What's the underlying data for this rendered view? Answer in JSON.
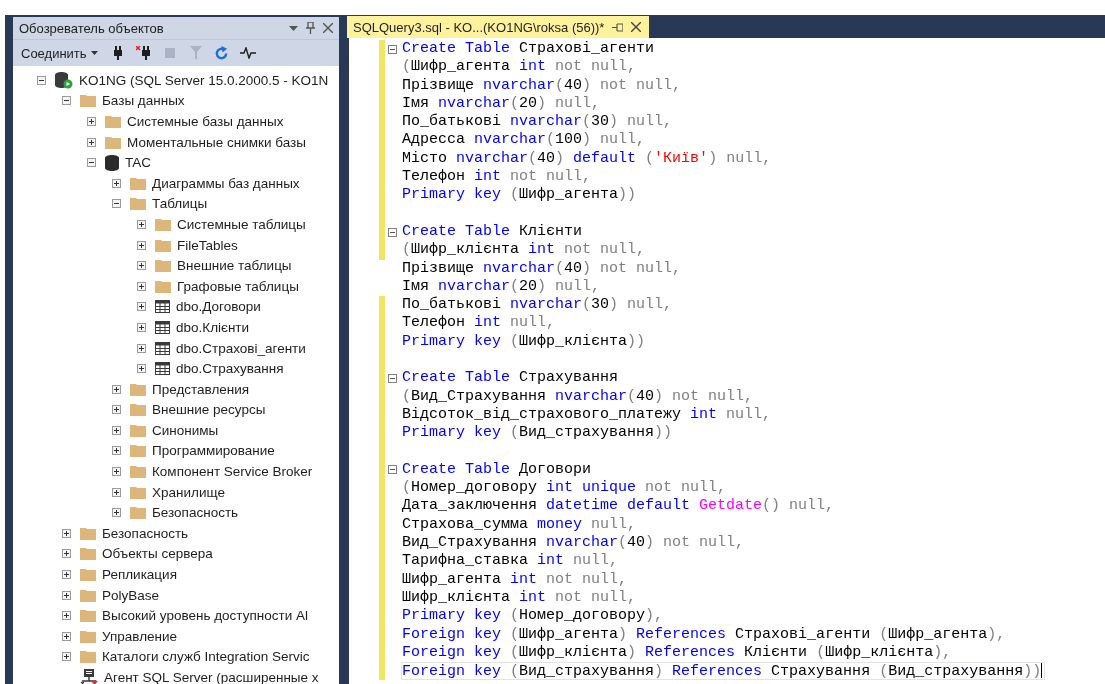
{
  "explorer": {
    "title": "Обозреватель объектов",
    "connect_label": "Соединить",
    "tools": [
      {
        "kind": "connect",
        "disabled": false
      },
      {
        "kind": "disconnect",
        "disabled": false
      },
      {
        "kind": "stop",
        "disabled": true
      },
      {
        "kind": "filter",
        "disabled": true
      },
      {
        "kind": "refresh",
        "disabled": false
      },
      {
        "kind": "activity",
        "disabled": false
      }
    ],
    "tree": [
      {
        "label": "KO1NG (SQL Server 15.0.2000.5 - KO1N",
        "kind": "server",
        "expanded": true,
        "children": [
          {
            "label": "Базы данных",
            "kind": "folder",
            "expanded": true,
            "children": [
              {
                "label": "Системные базы данных",
                "kind": "folder",
                "expanded": false
              },
              {
                "label": "Моментальные снимки базы",
                "kind": "folder",
                "expanded": false
              },
              {
                "label": "TAC",
                "kind": "database",
                "expanded": true,
                "children": [
                  {
                    "label": "Диаграммы баз данных",
                    "kind": "folder",
                    "expanded": false
                  },
                  {
                    "label": "Таблицы",
                    "kind": "folder",
                    "expanded": true,
                    "children": [
                      {
                        "label": "Системные таблицы",
                        "kind": "folder",
                        "expanded": false
                      },
                      {
                        "label": "FileTables",
                        "kind": "folder",
                        "expanded": false
                      },
                      {
                        "label": "Внешние таблицы",
                        "kind": "folder",
                        "expanded": false
                      },
                      {
                        "label": "Графовые таблицы",
                        "kind": "folder",
                        "expanded": false
                      },
                      {
                        "label": "dbo.Договори",
                        "kind": "table",
                        "expanded": false
                      },
                      {
                        "label": "dbo.Клієнти",
                        "kind": "table",
                        "expanded": false
                      },
                      {
                        "label": "dbo.Страхові_агенти",
                        "kind": "table",
                        "expanded": false
                      },
                      {
                        "label": "dbo.Страхування",
                        "kind": "table",
                        "expanded": false
                      }
                    ]
                  },
                  {
                    "label": "Представления",
                    "kind": "folder",
                    "expanded": false
                  },
                  {
                    "label": "Внешние ресурсы",
                    "kind": "folder",
                    "expanded": false
                  },
                  {
                    "label": "Синонимы",
                    "kind": "folder",
                    "expanded": false
                  },
                  {
                    "label": "Программирование",
                    "kind": "folder",
                    "expanded": false
                  },
                  {
                    "label": "Компонент Service Broker",
                    "kind": "folder",
                    "expanded": false
                  },
                  {
                    "label": "Хранилище",
                    "kind": "folder",
                    "expanded": false
                  },
                  {
                    "label": "Безопасность",
                    "kind": "folder",
                    "expanded": false
                  }
                ]
              }
            ]
          },
          {
            "label": "Безопасность",
            "kind": "folder",
            "expanded": false
          },
          {
            "label": "Объекты сервера",
            "kind": "folder",
            "expanded": false
          },
          {
            "label": "Репликация",
            "kind": "folder",
            "expanded": false
          },
          {
            "label": "PolyBase",
            "kind": "folder",
            "expanded": false
          },
          {
            "label": "Высокий уровень доступности Al",
            "kind": "folder",
            "expanded": false
          },
          {
            "label": "Управление",
            "kind": "folder",
            "expanded": false
          },
          {
            "label": "Каталоги служб Integration Servic",
            "kind": "folder",
            "expanded": false
          },
          {
            "label": "Агент SQL Server (расширенные х",
            "kind": "agent"
          }
        ]
      }
    ]
  },
  "editor": {
    "tab": {
      "title": "SQLQuery3.sql - KO...(KO1NG\\roksa (56))*",
      "selected": true
    },
    "lines": [
      {
        "modified": true,
        "fold": true,
        "current": false,
        "tokens": [
          {
            "kind": "kw",
            "text": "Create Table"
          },
          {
            "kind": "id",
            "text": " Страхові_агенти"
          }
        ]
      },
      {
        "modified": true,
        "fold": false,
        "current": false,
        "tokens": [
          {
            "kind": "op",
            "text": "("
          },
          {
            "kind": "id",
            "text": "Шифр_агента "
          },
          {
            "kind": "kw",
            "text": "int"
          },
          {
            "kind": "op",
            "text": " not null,"
          }
        ]
      },
      {
        "modified": true,
        "fold": false,
        "current": false,
        "tokens": [
          {
            "kind": "id",
            "text": "Прізвище "
          },
          {
            "kind": "kw",
            "text": "nvarchar"
          },
          {
            "kind": "op",
            "text": "("
          },
          {
            "kind": "id",
            "text": "40"
          },
          {
            "kind": "op",
            "text": ") not null,"
          }
        ]
      },
      {
        "modified": true,
        "fold": false,
        "current": false,
        "tokens": [
          {
            "kind": "id",
            "text": "Імя "
          },
          {
            "kind": "kw",
            "text": "nvarchar"
          },
          {
            "kind": "op",
            "text": "("
          },
          {
            "kind": "id",
            "text": "20"
          },
          {
            "kind": "op",
            "text": ") null,"
          }
        ]
      },
      {
        "modified": true,
        "fold": false,
        "current": false,
        "tokens": [
          {
            "kind": "id",
            "text": "По_батькові "
          },
          {
            "kind": "kw",
            "text": "nvarchar"
          },
          {
            "kind": "op",
            "text": "("
          },
          {
            "kind": "id",
            "text": "30"
          },
          {
            "kind": "op",
            "text": ") null,"
          }
        ]
      },
      {
        "modified": true,
        "fold": false,
        "current": false,
        "tokens": [
          {
            "kind": "id",
            "text": "Адресса "
          },
          {
            "kind": "kw",
            "text": "nvarchar"
          },
          {
            "kind": "op",
            "text": "("
          },
          {
            "kind": "id",
            "text": "100"
          },
          {
            "kind": "op",
            "text": ") null,"
          }
        ]
      },
      {
        "modified": true,
        "fold": false,
        "current": false,
        "tokens": [
          {
            "kind": "id",
            "text": "Місто "
          },
          {
            "kind": "kw",
            "text": "nvarchar"
          },
          {
            "kind": "op",
            "text": "("
          },
          {
            "kind": "id",
            "text": "40"
          },
          {
            "kind": "op",
            "text": ") "
          },
          {
            "kind": "kw",
            "text": "default"
          },
          {
            "kind": "op",
            "text": " ("
          },
          {
            "kind": "str",
            "text": "'Київ'"
          },
          {
            "kind": "op",
            "text": ") null,"
          }
        ]
      },
      {
        "modified": true,
        "fold": false,
        "current": false,
        "tokens": [
          {
            "kind": "id",
            "text": "Телефон "
          },
          {
            "kind": "kw",
            "text": "int"
          },
          {
            "kind": "op",
            "text": " not null,"
          }
        ]
      },
      {
        "modified": true,
        "fold": false,
        "current": false,
        "tokens": [
          {
            "kind": "kw",
            "text": "Primary key"
          },
          {
            "kind": "op",
            "text": " ("
          },
          {
            "kind": "id",
            "text": "Шифр_агента"
          },
          {
            "kind": "op",
            "text": "))"
          }
        ]
      },
      {
        "modified": true,
        "fold": false,
        "current": false
      },
      {
        "modified": true,
        "fold": true,
        "current": false,
        "tokens": [
          {
            "kind": "kw",
            "text": "Create Table"
          },
          {
            "kind": "id",
            "text": " Клієнти"
          }
        ]
      },
      {
        "modified": true,
        "fold": false,
        "current": false,
        "tokens": [
          {
            "kind": "op",
            "text": "("
          },
          {
            "kind": "id",
            "text": "Шифр_клієнта "
          },
          {
            "kind": "kw",
            "text": "int"
          },
          {
            "kind": "op",
            "text": " not null,"
          }
        ]
      },
      {
        "modified": false,
        "fold": false,
        "current": false,
        "tokens": [
          {
            "kind": "id",
            "text": "Прізвище "
          },
          {
            "kind": "kw",
            "text": "nvarchar"
          },
          {
            "kind": "op",
            "text": "("
          },
          {
            "kind": "id",
            "text": "40"
          },
          {
            "kind": "op",
            "text": ") not null,"
          }
        ]
      },
      {
        "modified": false,
        "fold": false,
        "current": false,
        "tokens": [
          {
            "kind": "id",
            "text": "Імя "
          },
          {
            "kind": "kw",
            "text": "nvarchar"
          },
          {
            "kind": "op",
            "text": "("
          },
          {
            "kind": "id",
            "text": "20"
          },
          {
            "kind": "op",
            "text": ") null,"
          }
        ]
      },
      {
        "modified": true,
        "fold": false,
        "current": false,
        "tokens": [
          {
            "kind": "id",
            "text": "По_батькові "
          },
          {
            "kind": "kw",
            "text": "nvarchar"
          },
          {
            "kind": "op",
            "text": "("
          },
          {
            "kind": "id",
            "text": "30"
          },
          {
            "kind": "op",
            "text": ") null,"
          }
        ]
      },
      {
        "modified": true,
        "fold": false,
        "current": false,
        "tokens": [
          {
            "kind": "id",
            "text": "Телефон "
          },
          {
            "kind": "kw",
            "text": "int"
          },
          {
            "kind": "op",
            "text": " null,"
          }
        ]
      },
      {
        "modified": true,
        "fold": false,
        "current": false,
        "tokens": [
          {
            "kind": "kw",
            "text": "Primary key"
          },
          {
            "kind": "op",
            "text": " ("
          },
          {
            "kind": "id",
            "text": "Шифр_клієнта"
          },
          {
            "kind": "op",
            "text": "))"
          }
        ]
      },
      {
        "modified": true,
        "fold": false,
        "current": false
      },
      {
        "modified": true,
        "fold": true,
        "current": false,
        "tokens": [
          {
            "kind": "kw",
            "text": "Create Table"
          },
          {
            "kind": "id",
            "text": " Страхування"
          }
        ]
      },
      {
        "modified": true,
        "fold": false,
        "current": false,
        "tokens": [
          {
            "kind": "op",
            "text": "("
          },
          {
            "kind": "id",
            "text": "Вид_Страхування "
          },
          {
            "kind": "kw",
            "text": "nvarchar"
          },
          {
            "kind": "op",
            "text": "("
          },
          {
            "kind": "id",
            "text": "40"
          },
          {
            "kind": "op",
            "text": ") not null,"
          }
        ]
      },
      {
        "modified": true,
        "fold": false,
        "current": false,
        "tokens": [
          {
            "kind": "id",
            "text": "Відсоток_від_страхового_платежу "
          },
          {
            "kind": "kw",
            "text": "int"
          },
          {
            "kind": "op",
            "text": " null,"
          }
        ]
      },
      {
        "modified": true,
        "fold": false,
        "current": false,
        "tokens": [
          {
            "kind": "kw",
            "text": "Primary key"
          },
          {
            "kind": "op",
            "text": " ("
          },
          {
            "kind": "id",
            "text": "Вид_страхування"
          },
          {
            "kind": "op",
            "text": "))"
          }
        ]
      },
      {
        "modified": true,
        "fold": false,
        "current": false
      },
      {
        "modified": true,
        "fold": true,
        "current": false,
        "tokens": [
          {
            "kind": "kw",
            "text": "Create Table"
          },
          {
            "kind": "id",
            "text": " Договори"
          }
        ]
      },
      {
        "modified": true,
        "fold": false,
        "current": false,
        "tokens": [
          {
            "kind": "op",
            "text": "("
          },
          {
            "kind": "id",
            "text": "Номер_договору "
          },
          {
            "kind": "kw",
            "text": "int unique"
          },
          {
            "kind": "op",
            "text": " not null,"
          }
        ]
      },
      {
        "modified": true,
        "fold": false,
        "current": false,
        "tokens": [
          {
            "kind": "id",
            "text": "Дата_заключення "
          },
          {
            "kind": "kw",
            "text": "datetime default "
          },
          {
            "kind": "fn",
            "text": "Getdate"
          },
          {
            "kind": "op",
            "text": "() null,"
          }
        ]
      },
      {
        "modified": true,
        "fold": false,
        "current": false,
        "tokens": [
          {
            "kind": "id",
            "text": "Страхова_сумма "
          },
          {
            "kind": "kw",
            "text": "money"
          },
          {
            "kind": "op",
            "text": " null,"
          }
        ]
      },
      {
        "modified": true,
        "fold": false,
        "current": false,
        "tokens": [
          {
            "kind": "id",
            "text": "Вид_Страхування "
          },
          {
            "kind": "kw",
            "text": "nvarchar"
          },
          {
            "kind": "op",
            "text": "("
          },
          {
            "kind": "id",
            "text": "40"
          },
          {
            "kind": "op",
            "text": ") not null,"
          }
        ]
      },
      {
        "modified": true,
        "fold": false,
        "current": false,
        "tokens": [
          {
            "kind": "id",
            "text": "Тарифна_ставка "
          },
          {
            "kind": "kw",
            "text": "int"
          },
          {
            "kind": "op",
            "text": " null,"
          }
        ]
      },
      {
        "modified": true,
        "fold": false,
        "current": false,
        "tokens": [
          {
            "kind": "id",
            "text": "Шифр_агента "
          },
          {
            "kind": "kw",
            "text": "int"
          },
          {
            "kind": "op",
            "text": " not null,"
          }
        ]
      },
      {
        "modified": true,
        "fold": false,
        "current": false,
        "tokens": [
          {
            "kind": "id",
            "text": "Шифр_клієнта "
          },
          {
            "kind": "kw",
            "text": "int"
          },
          {
            "kind": "op",
            "text": " not null,"
          }
        ]
      },
      {
        "modified": true,
        "fold": false,
        "current": false,
        "tokens": [
          {
            "kind": "kw",
            "text": "Primary key"
          },
          {
            "kind": "op",
            "text": " ("
          },
          {
            "kind": "id",
            "text": "Номер_договору"
          },
          {
            "kind": "op",
            "text": "),"
          }
        ]
      },
      {
        "modified": true,
        "fold": false,
        "current": false,
        "tokens": [
          {
            "kind": "kw",
            "text": "Foreign key"
          },
          {
            "kind": "op",
            "text": " ("
          },
          {
            "kind": "id",
            "text": "Шифр_агента"
          },
          {
            "kind": "op",
            "text": ") "
          },
          {
            "kind": "kw",
            "text": "References"
          },
          {
            "kind": "id",
            "text": " Страхові_агенти "
          },
          {
            "kind": "op",
            "text": "("
          },
          {
            "kind": "id",
            "text": "Шифр_агента"
          },
          {
            "kind": "op",
            "text": "),"
          }
        ]
      },
      {
        "modified": true,
        "fold": false,
        "current": false,
        "tokens": [
          {
            "kind": "kw",
            "text": "Foreign key"
          },
          {
            "kind": "op",
            "text": " ("
          },
          {
            "kind": "id",
            "text": "Шифр_клієнта"
          },
          {
            "kind": "op",
            "text": ") "
          },
          {
            "kind": "kw",
            "text": "References"
          },
          {
            "kind": "id",
            "text": " Клієнти "
          },
          {
            "kind": "op",
            "text": "("
          },
          {
            "kind": "id",
            "text": "Шифр_клієнта"
          },
          {
            "kind": "op",
            "text": "),"
          }
        ]
      },
      {
        "modified": true,
        "fold": false,
        "current": true,
        "tokens": [
          {
            "kind": "kw",
            "text": "Foreign key"
          },
          {
            "kind": "op",
            "text": " ("
          },
          {
            "kind": "id",
            "text": "Вид_страхування"
          },
          {
            "kind": "op",
            "text": ") "
          },
          {
            "kind": "kw",
            "text": "References"
          },
          {
            "kind": "id",
            "text": " Страхування "
          },
          {
            "kind": "op",
            "text": "("
          },
          {
            "kind": "id",
            "text": "Вид_страхування"
          },
          {
            "kind": "op",
            "text": "))"
          }
        ]
      }
    ]
  }
}
